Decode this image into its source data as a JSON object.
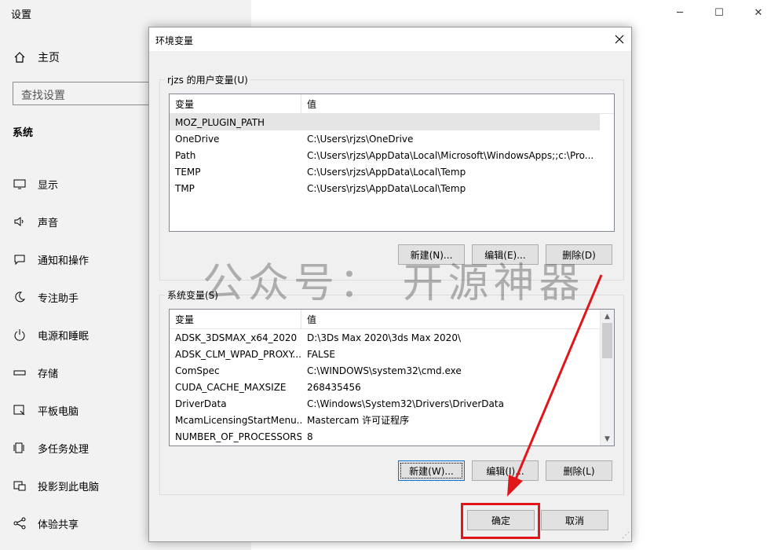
{
  "settings": {
    "title": "设置",
    "home_label": "主页",
    "search_placeholder": "查找设置",
    "section": "系统",
    "nav": [
      {
        "label": "显示",
        "icon": "monitor-icon"
      },
      {
        "label": "声音",
        "icon": "speaker-icon"
      },
      {
        "label": "通知和操作",
        "icon": "notification-icon"
      },
      {
        "label": "专注助手",
        "icon": "moon-icon"
      },
      {
        "label": "电源和睡眠",
        "icon": "power-icon"
      },
      {
        "label": "存储",
        "icon": "storage-icon"
      },
      {
        "label": "平板电脑",
        "icon": "tablet-icon"
      },
      {
        "label": "多任务处理",
        "icon": "multitask-icon"
      },
      {
        "label": "投影到此电脑",
        "icon": "project-icon"
      },
      {
        "label": "体验共享",
        "icon": "share-icon"
      }
    ]
  },
  "dialog": {
    "title": "环境变量",
    "user_group_label": "rjzs 的用户变量(U)",
    "system_group_label": "系统变量(S)",
    "col_variable": "变量",
    "col_value": "值",
    "user_vars": [
      {
        "name": "MOZ_PLUGIN_PATH",
        "value": ""
      },
      {
        "name": "OneDrive",
        "value": "C:\\Users\\rjzs\\OneDrive"
      },
      {
        "name": "Path",
        "value": "C:\\Users\\rjzs\\AppData\\Local\\Microsoft\\WindowsApps;;c:\\Pro..."
      },
      {
        "name": "TEMP",
        "value": "C:\\Users\\rjzs\\AppData\\Local\\Temp"
      },
      {
        "name": "TMP",
        "value": "C:\\Users\\rjzs\\AppData\\Local\\Temp"
      }
    ],
    "system_vars": [
      {
        "name": "ADSK_3DSMAX_x64_2020",
        "value": "D:\\3Ds Max 2020\\3ds Max 2020\\"
      },
      {
        "name": "ADSK_CLM_WPAD_PROXY...",
        "value": "FALSE"
      },
      {
        "name": "ComSpec",
        "value": "C:\\WINDOWS\\system32\\cmd.exe"
      },
      {
        "name": "CUDA_CACHE_MAXSIZE",
        "value": "268435456"
      },
      {
        "name": "DriverData",
        "value": "C:\\Windows\\System32\\Drivers\\DriverData"
      },
      {
        "name": "McamLicensingStartMenu...",
        "value": "Mastercam 许可证程序"
      },
      {
        "name": "NUMBER_OF_PROCESSORS",
        "value": "8"
      }
    ],
    "user_buttons": {
      "new": "新建(N)...",
      "edit": "编辑(E)...",
      "delete": "删除(D)"
    },
    "system_buttons": {
      "new": "新建(W)...",
      "edit": "编辑(I)...",
      "delete": "删除(L)"
    },
    "ok": "确定",
    "cancel": "取消"
  },
  "watermark": "公众号： 开源神器",
  "annotation_color": "#e0161a"
}
